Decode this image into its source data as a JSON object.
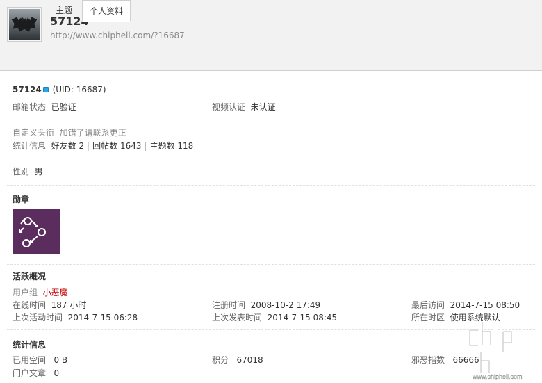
{
  "header": {
    "username": "57124",
    "space_url": "http://www.chiphell.com/?16687"
  },
  "tabs": [
    {
      "label": "主题"
    },
    {
      "label": "个人资料"
    }
  ],
  "profile": {
    "name": "57124",
    "uid": "(UID: 16687)",
    "email_status_label": "邮箱状态",
    "email_status_value": "已验证",
    "video_auth_label": "视频认证",
    "video_auth_value": "未认证",
    "custom_title_label": "自定义头衔",
    "custom_title_value": "加错了请联系更正",
    "stats_label": "统计信息",
    "friends": "好友数 2",
    "replies": "回帖数 1643",
    "threads": "主题数 118",
    "gender_label": "性别",
    "gender_value": "男"
  },
  "medals": {
    "heading": "勋章",
    "medal_icon": "arrows-cycle-medal-icon"
  },
  "activity": {
    "heading": "活跃概况",
    "usergroup_label": "用户组",
    "usergroup_value": "小恶魔",
    "online_label": "在线时间",
    "online_value": "187 小时",
    "register_label": "注册时间",
    "register_value": "2008-10-2 17:49",
    "lastvisit_label": "最后访问",
    "lastvisit_value": "2014-7-15 08:50",
    "lastactive_label": "上次活动时间",
    "lastactive_value": "2014-7-15 06:28",
    "lastpost_label": "上次发表时间",
    "lastpost_value": "2014-7-15 08:45",
    "timezone_label": "所在时区",
    "timezone_value": "使用系统默认"
  },
  "statistics": {
    "heading": "统计信息",
    "space_label": "已用空间",
    "space_value": "0 B",
    "points_label": "积分",
    "points_value": "67018",
    "evil_label": "邪恶指数",
    "evil_value": "66666",
    "articles_label": "门户文章",
    "articles_value": "0"
  },
  "watermark": {
    "text": "chiphell",
    "url": "www.chiphell.com"
  },
  "colors": {
    "header_bg": "#f2f2f2",
    "usergroup": "#c00000",
    "medal_bg": "#5b2d5e",
    "online_dot": "#2aa7e8"
  }
}
